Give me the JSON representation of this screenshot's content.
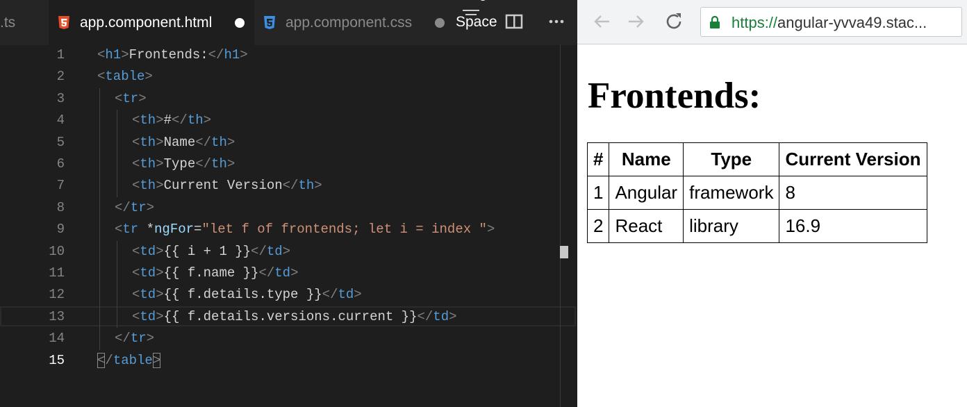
{
  "editor": {
    "tabs": [
      {
        "label": ".ts",
        "active": false
      },
      {
        "label": "app.component.html",
        "active": true,
        "modified": true,
        "icon": "html5-icon"
      },
      {
        "label": "app.component.css",
        "active": false,
        "modified": true,
        "icon": "css3-icon"
      }
    ],
    "space_hint": "Space",
    "space_hint_top": "+U",
    "current_line": 15,
    "lines": [
      {
        "n": "1",
        "indent": 0,
        "parts": [
          [
            "br",
            "<"
          ],
          [
            "tg",
            "h1"
          ],
          [
            "br",
            ">"
          ],
          [
            "wt",
            "Frontends:"
          ],
          [
            "br",
            "</"
          ],
          [
            "tg",
            "h1"
          ],
          [
            "br",
            ">"
          ]
        ]
      },
      {
        "n": "2",
        "indent": 0,
        "parts": [
          [
            "br",
            "<"
          ],
          [
            "tg",
            "table"
          ],
          [
            "br",
            ">"
          ]
        ]
      },
      {
        "n": "3",
        "indent": 1,
        "parts": [
          [
            "br",
            "<"
          ],
          [
            "tg",
            "tr"
          ],
          [
            "br",
            ">"
          ]
        ]
      },
      {
        "n": "4",
        "indent": 2,
        "parts": [
          [
            "br",
            "<"
          ],
          [
            "tg",
            "th"
          ],
          [
            "br",
            ">"
          ],
          [
            "wt",
            "#"
          ],
          [
            "br",
            "</"
          ],
          [
            "tg",
            "th"
          ],
          [
            "br",
            ">"
          ]
        ]
      },
      {
        "n": "5",
        "indent": 2,
        "parts": [
          [
            "br",
            "<"
          ],
          [
            "tg",
            "th"
          ],
          [
            "br",
            ">"
          ],
          [
            "wt",
            "Name"
          ],
          [
            "br",
            "</"
          ],
          [
            "tg",
            "th"
          ],
          [
            "br",
            ">"
          ]
        ]
      },
      {
        "n": "6",
        "indent": 2,
        "parts": [
          [
            "br",
            "<"
          ],
          [
            "tg",
            "th"
          ],
          [
            "br",
            ">"
          ],
          [
            "wt",
            "Type"
          ],
          [
            "br",
            "</"
          ],
          [
            "tg",
            "th"
          ],
          [
            "br",
            ">"
          ]
        ]
      },
      {
        "n": "7",
        "indent": 2,
        "parts": [
          [
            "br",
            "<"
          ],
          [
            "tg",
            "th"
          ],
          [
            "br",
            ">"
          ],
          [
            "wt",
            "Current Version"
          ],
          [
            "br",
            "</"
          ],
          [
            "tg",
            "th"
          ],
          [
            "br",
            ">"
          ]
        ]
      },
      {
        "n": "8",
        "indent": 1,
        "parts": [
          [
            "br",
            "</"
          ],
          [
            "tg",
            "tr"
          ],
          [
            "br",
            ">"
          ]
        ]
      },
      {
        "n": "9",
        "indent": 1,
        "parts": [
          [
            "br",
            "<"
          ],
          [
            "tg",
            "tr"
          ],
          [
            "wt",
            " *"
          ],
          [
            "at",
            "ngFor"
          ],
          [
            "wt",
            "="
          ],
          [
            "st",
            "\"let f of frontends; let i = index \""
          ],
          [
            "br",
            ">"
          ]
        ]
      },
      {
        "n": "10",
        "indent": 2,
        "parts": [
          [
            "br",
            "<"
          ],
          [
            "tg",
            "td"
          ],
          [
            "br",
            ">"
          ],
          [
            "wt",
            "{{ i + 1 }}"
          ],
          [
            "br",
            "</"
          ],
          [
            "tg",
            "td"
          ],
          [
            "br",
            ">"
          ]
        ]
      },
      {
        "n": "11",
        "indent": 2,
        "parts": [
          [
            "br",
            "<"
          ],
          [
            "tg",
            "td"
          ],
          [
            "br",
            ">"
          ],
          [
            "wt",
            "{{ f.name }}"
          ],
          [
            "br",
            "</"
          ],
          [
            "tg",
            "td"
          ],
          [
            "br",
            ">"
          ]
        ]
      },
      {
        "n": "12",
        "indent": 2,
        "parts": [
          [
            "br",
            "<"
          ],
          [
            "tg",
            "td"
          ],
          [
            "br",
            ">"
          ],
          [
            "wt",
            "{{ f.details.type }}"
          ],
          [
            "br",
            "</"
          ],
          [
            "tg",
            "td"
          ],
          [
            "br",
            ">"
          ]
        ]
      },
      {
        "n": "13",
        "indent": 2,
        "parts": [
          [
            "br",
            "<"
          ],
          [
            "tg",
            "td"
          ],
          [
            "br",
            ">"
          ],
          [
            "wt",
            "{{ f.details.versions.current }}"
          ],
          [
            "br",
            "</"
          ],
          [
            "tg",
            "td"
          ],
          [
            "br",
            ">"
          ]
        ]
      },
      {
        "n": "14",
        "indent": 1,
        "parts": [
          [
            "br",
            "</"
          ],
          [
            "tg",
            "tr"
          ],
          [
            "br",
            ">"
          ]
        ]
      },
      {
        "n": "15",
        "indent": 0,
        "parts": [
          [
            "bm",
            "<"
          ],
          [
            "br",
            "/"
          ],
          [
            "tg",
            "table"
          ],
          [
            "bm",
            ">"
          ]
        ]
      }
    ]
  },
  "browser": {
    "url_scheme": "https://",
    "url_rest": "angular-yvva49.stac...",
    "heading": "Frontends:",
    "table": {
      "headers": [
        "#",
        "Name",
        "Type",
        "Current Version"
      ],
      "rows": [
        [
          "1",
          "Angular",
          "framework",
          "8"
        ],
        [
          "2",
          "React",
          "library",
          "16.9"
        ]
      ]
    }
  },
  "colors": {
    "tag": "#569cd6",
    "bracket": "#808080",
    "attribute": "#9cdcfe",
    "string": "#ce9178",
    "lock": "#188038"
  }
}
